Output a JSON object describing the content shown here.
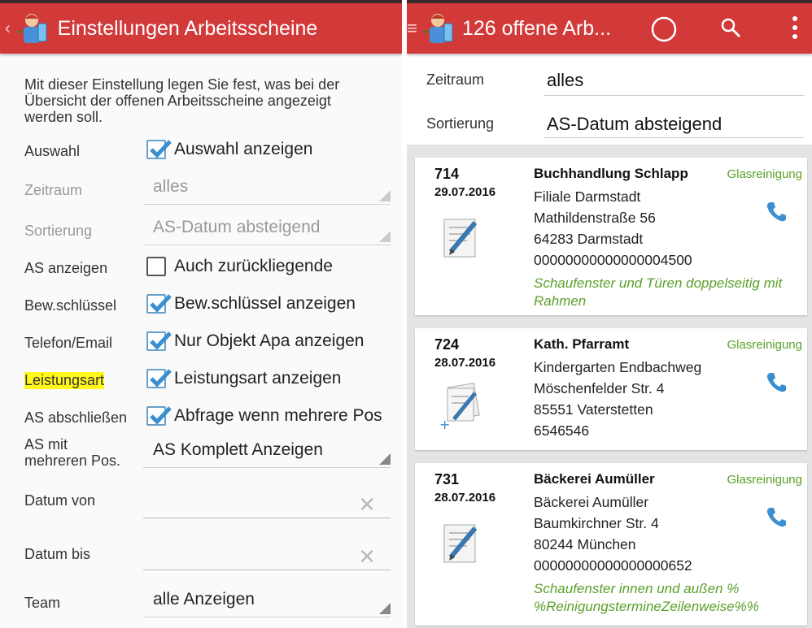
{
  "left": {
    "title": "Einstellungen Arbeitsscheine",
    "description": "Mit dieser Einstellung legen Sie fest, was bei der Übersicht der offenen Arbeitsscheine angezeigt werden soll.",
    "rows": [
      {
        "label": "Auswahl",
        "type": "checkbox",
        "checked": true,
        "text": "Auswahl anzeigen"
      },
      {
        "label": "Zeitraum",
        "type": "spinner",
        "disabled": true,
        "text": "alles"
      },
      {
        "label": "Sortierung",
        "type": "spinner",
        "disabled": true,
        "text": "AS-Datum absteigend"
      },
      {
        "label": "AS anzeigen",
        "type": "checkbox",
        "checked": false,
        "text": "Auch zurückliegende"
      },
      {
        "label": "Bew.schlüssel",
        "type": "checkbox",
        "checked": true,
        "text": "Bew.schlüssel anzeigen"
      },
      {
        "label": "Telefon/Email",
        "type": "checkbox",
        "checked": true,
        "text": "Nur Objekt Apa anzeigen"
      },
      {
        "label": "Leistungsart",
        "type": "checkbox",
        "checked": true,
        "text": "Leistungsart anzeigen"
      },
      {
        "label": "AS abschließen",
        "type": "checkbox",
        "checked": true,
        "text": "Abfrage wenn mehrere Pos"
      },
      {
        "label_line1": "AS mit",
        "label_line2": "mehreren Pos.",
        "type": "spinner",
        "text": "AS Komplett Anzeigen"
      },
      {
        "label": "Datum von",
        "type": "date",
        "text": ""
      },
      {
        "label": "Datum bis",
        "type": "date",
        "text": ""
      },
      {
        "label": "Team",
        "type": "spinner",
        "text": "alle Anzeigen"
      }
    ]
  },
  "right": {
    "title": "126 offene Arb...",
    "filter": {
      "zeitraum_label": "Zeitraum",
      "zeitraum_value": "alles",
      "sortierung_label": "Sortierung",
      "sortierung_value": "AS-Datum absteigend"
    },
    "cards": [
      {
        "number": "714",
        "date": "29.07.2016",
        "name": "Buchhandlung Schlapp",
        "kind": "Glasreinigung",
        "line1": "Filiale Darmstadt",
        "line2": "Mathildenstraße 56",
        "line3": "64283 Darmstadt",
        "line4": "00000000000000004500",
        "note": "Schaufenster und Türen doppelseitig mit Rahmen"
      },
      {
        "number": "724",
        "date": "28.07.2016",
        "name": "Kath. Pfarramt",
        "kind": "Glasreinigung",
        "line1": "Kindergarten Endbachweg",
        "line2": "Möschenfelder Str. 4",
        "line3": "85551 Vaterstetten",
        "line4": "6546546",
        "note": ""
      },
      {
        "number": "731",
        "date": "28.07.2016",
        "name": "Bäckerei Aumüller",
        "kind": "Glasreinigung",
        "line1": "Bäckerei Aumüller",
        "line2": "Baumkirchner Str. 4",
        "line3": "80244 München",
        "line4": "00000000000000000652",
        "note": "Schaufenster innen und außen % %ReinigungstermineZeilenweise%%"
      }
    ]
  },
  "icons": {
    "app": "worker-app-icon",
    "back": "back-caret-icon",
    "drawer": "drawer-icon",
    "sync": "sync-circle-icon",
    "search": "search-icon",
    "overflow": "overflow-menu-icon",
    "check": "checkmark-icon",
    "clear": "clear-x-icon",
    "phone": "phone-icon",
    "doc": "document-edit-icon",
    "doc_add": "documents-add-icon"
  },
  "colors": {
    "appbar": "#d23a3a",
    "accent_green": "#5aa02a",
    "checkbox": "#3a8fd0",
    "highlight": "#fff81a"
  }
}
